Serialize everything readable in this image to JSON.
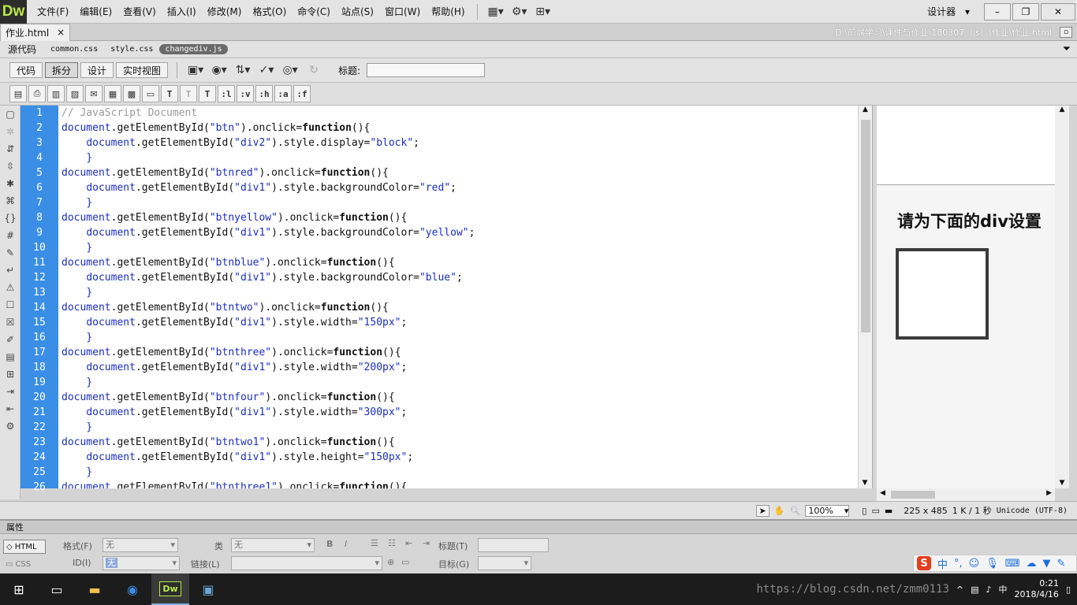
{
  "app": {
    "logo": "Dw"
  },
  "menu": [
    "文件(F)",
    "编辑(E)",
    "查看(V)",
    "插入(I)",
    "修改(M)",
    "格式(O)",
    "命令(C)",
    "站点(S)",
    "窗口(W)",
    "帮助(H)"
  ],
  "toolbar_icons": [
    "layout-icon",
    "gear-icon",
    "site-icon"
  ],
  "workspace": {
    "label": "设计器",
    "arrow": "▾"
  },
  "window_controls": {
    "minimize": "–",
    "restore": "❐",
    "close": "✕"
  },
  "document_tab": {
    "name": "作业.html",
    "close": "×"
  },
  "file_path": "D:\\前端学习\\课件与作业\\180307（js）\\作业\\作业.html",
  "related_files": {
    "source": "源代码",
    "files": [
      "common.css",
      "style.css",
      "changediv.js"
    ],
    "active_index": 2
  },
  "doc_toolbar": {
    "views": [
      "代码",
      "拆分",
      "设计",
      "实时视图"
    ],
    "active_view": 1,
    "title_label": "标题:",
    "title_value": ""
  },
  "code_toolbar": {
    "text_buttons": [
      "T",
      "T",
      "T",
      ":l",
      ":v",
      ":h",
      ":a",
      ":f"
    ]
  },
  "line_numbers": [
    "1",
    "2",
    "3",
    "4",
    "5",
    "6",
    "7",
    "8",
    "9",
    "10",
    "11",
    "12",
    "13",
    "14",
    "15",
    "16",
    "17",
    "18",
    "19",
    "20",
    "21",
    "22",
    "23",
    "24",
    "25",
    "26"
  ],
  "code_lines": [
    {
      "indent": "",
      "parts": [
        [
          "cmt",
          "// JavaScript Document"
        ]
      ]
    },
    {
      "indent": "",
      "parts": [
        [
          "obj",
          "document"
        ],
        [
          "",
          "."
        ],
        [
          "",
          "getElementById("
        ],
        [
          "str",
          "\"btn\""
        ],
        [
          "",
          ").onclick="
        ],
        [
          "kw",
          "function"
        ],
        [
          "",
          "(){"
        ]
      ]
    },
    {
      "indent": "    ",
      "parts": [
        [
          "obj",
          "document"
        ],
        [
          "",
          ".getElementById("
        ],
        [
          "str",
          "\"div2\""
        ],
        [
          "",
          ").style.display="
        ],
        [
          "str",
          "\"block\""
        ],
        [
          "",
          ";"
        ]
      ]
    },
    {
      "indent": "    ",
      "parts": [
        [
          "obj",
          "}"
        ]
      ]
    },
    {
      "indent": "",
      "parts": [
        [
          "obj",
          "document"
        ],
        [
          "",
          ".getElementById("
        ],
        [
          "str",
          "\"btnred\""
        ],
        [
          "",
          ").onclick="
        ],
        [
          "kw",
          "function"
        ],
        [
          "",
          "(){"
        ]
      ]
    },
    {
      "indent": "    ",
      "parts": [
        [
          "obj",
          "document"
        ],
        [
          "",
          ".getElementById("
        ],
        [
          "str",
          "\"div1\""
        ],
        [
          "",
          ").style.backgroundColor="
        ],
        [
          "str",
          "\"red\""
        ],
        [
          "",
          ";"
        ]
      ]
    },
    {
      "indent": "    ",
      "parts": [
        [
          "obj",
          "}"
        ]
      ]
    },
    {
      "indent": "",
      "parts": [
        [
          "obj",
          "document"
        ],
        [
          "",
          ".getElementById("
        ],
        [
          "str",
          "\"btnyellow\""
        ],
        [
          "",
          ").onclick="
        ],
        [
          "kw",
          "function"
        ],
        [
          "",
          "(){"
        ]
      ]
    },
    {
      "indent": "    ",
      "parts": [
        [
          "obj",
          "document"
        ],
        [
          "",
          ".getElementById("
        ],
        [
          "str",
          "\"div1\""
        ],
        [
          "",
          ").style.backgroundColor="
        ],
        [
          "str",
          "\"yellow\""
        ],
        [
          "",
          ";"
        ]
      ]
    },
    {
      "indent": "    ",
      "parts": [
        [
          "obj",
          "}"
        ]
      ]
    },
    {
      "indent": "",
      "parts": [
        [
          "obj",
          "document"
        ],
        [
          "",
          ".getElementById("
        ],
        [
          "str",
          "\"btnblue\""
        ],
        [
          "",
          ").onclick="
        ],
        [
          "kw",
          "function"
        ],
        [
          "",
          "(){"
        ]
      ]
    },
    {
      "indent": "    ",
      "parts": [
        [
          "obj",
          "document"
        ],
        [
          "",
          ".getElementById("
        ],
        [
          "str",
          "\"div1\""
        ],
        [
          "",
          ").style.backgroundColor="
        ],
        [
          "str",
          "\"blue\""
        ],
        [
          "",
          ";"
        ]
      ]
    },
    {
      "indent": "    ",
      "parts": [
        [
          "obj",
          "}"
        ]
      ]
    },
    {
      "indent": "",
      "parts": [
        [
          "obj",
          "document"
        ],
        [
          "",
          ".getElementById("
        ],
        [
          "str",
          "\"btntwo\""
        ],
        [
          "",
          ").onclick="
        ],
        [
          "kw",
          "function"
        ],
        [
          "",
          "(){"
        ]
      ]
    },
    {
      "indent": "    ",
      "parts": [
        [
          "obj",
          "document"
        ],
        [
          "",
          ".getElementById("
        ],
        [
          "str",
          "\"div1\""
        ],
        [
          "",
          ").style.width="
        ],
        [
          "str",
          "\"150px\""
        ],
        [
          "",
          ";"
        ]
      ]
    },
    {
      "indent": "    ",
      "parts": [
        [
          "obj",
          "}"
        ]
      ]
    },
    {
      "indent": "",
      "parts": [
        [
          "obj",
          "document"
        ],
        [
          "",
          ".getElementById("
        ],
        [
          "str",
          "\"btnthree\""
        ],
        [
          "",
          ").onclick="
        ],
        [
          "kw",
          "function"
        ],
        [
          "",
          "(){"
        ]
      ]
    },
    {
      "indent": "    ",
      "parts": [
        [
          "obj",
          "document"
        ],
        [
          "",
          ".getElementById("
        ],
        [
          "str",
          "\"div1\""
        ],
        [
          "",
          ").style.width="
        ],
        [
          "str",
          "\"200px\""
        ],
        [
          "",
          ";"
        ]
      ]
    },
    {
      "indent": "    ",
      "parts": [
        [
          "obj",
          "}"
        ]
      ]
    },
    {
      "indent": "",
      "parts": [
        [
          "obj",
          "document"
        ],
        [
          "",
          ".getElementById("
        ],
        [
          "str",
          "\"btnfour\""
        ],
        [
          "",
          ").onclick="
        ],
        [
          "kw",
          "function"
        ],
        [
          "",
          "(){"
        ]
      ]
    },
    {
      "indent": "    ",
      "parts": [
        [
          "obj",
          "document"
        ],
        [
          "",
          ".getElementById("
        ],
        [
          "str",
          "\"div1\""
        ],
        [
          "",
          ").style.width="
        ],
        [
          "str",
          "\"300px\""
        ],
        [
          "",
          ";"
        ]
      ]
    },
    {
      "indent": "    ",
      "parts": [
        [
          "obj",
          "}"
        ]
      ]
    },
    {
      "indent": "",
      "parts": [
        [
          "obj",
          "document"
        ],
        [
          "",
          ".getElementById("
        ],
        [
          "str",
          "\"btntwo1\""
        ],
        [
          "",
          ").onclick="
        ],
        [
          "kw",
          "function"
        ],
        [
          "",
          "(){"
        ]
      ]
    },
    {
      "indent": "    ",
      "parts": [
        [
          "obj",
          "document"
        ],
        [
          "",
          ".getElementById("
        ],
        [
          "str",
          "\"div1\""
        ],
        [
          "",
          ").style.height="
        ],
        [
          "str",
          "\"150px\""
        ],
        [
          "",
          ";"
        ]
      ]
    },
    {
      "indent": "    ",
      "parts": [
        [
          "obj",
          "}"
        ]
      ]
    },
    {
      "indent": "",
      "parts": [
        [
          "obj",
          "document"
        ],
        [
          "",
          ".getElementById("
        ],
        [
          "str",
          "\"btnthree1\""
        ],
        [
          "",
          ").onclick="
        ],
        [
          "kw",
          "function"
        ],
        [
          "",
          "(){"
        ]
      ]
    }
  ],
  "design_view": {
    "heading": "请为下面的div设置"
  },
  "status": {
    "zoom": "100%",
    "dimensions": "225 x 485",
    "size": "1 K / 1 秒",
    "encoding": "Unicode (UTF-8)"
  },
  "properties": {
    "header": "属性",
    "html_tab": "HTML",
    "css_tab": "CSS",
    "format_label": "格式(F)",
    "format_value": "无",
    "class_label": "类",
    "class_value": "无",
    "id_label": "ID(I)",
    "id_value": "无",
    "link_label": "链接(L)",
    "title_label": "标题(T)",
    "target_label": "目标(G)"
  },
  "taskbar": {
    "time": "0:21",
    "date": "2018/4/16",
    "ime_lang": "中",
    "watermark": "https://blog.csdn.net/zmm0113"
  },
  "colors": {
    "gutter": "#3a8ee6",
    "string": "#1b2dc0",
    "comment": "#9a9a9a"
  }
}
